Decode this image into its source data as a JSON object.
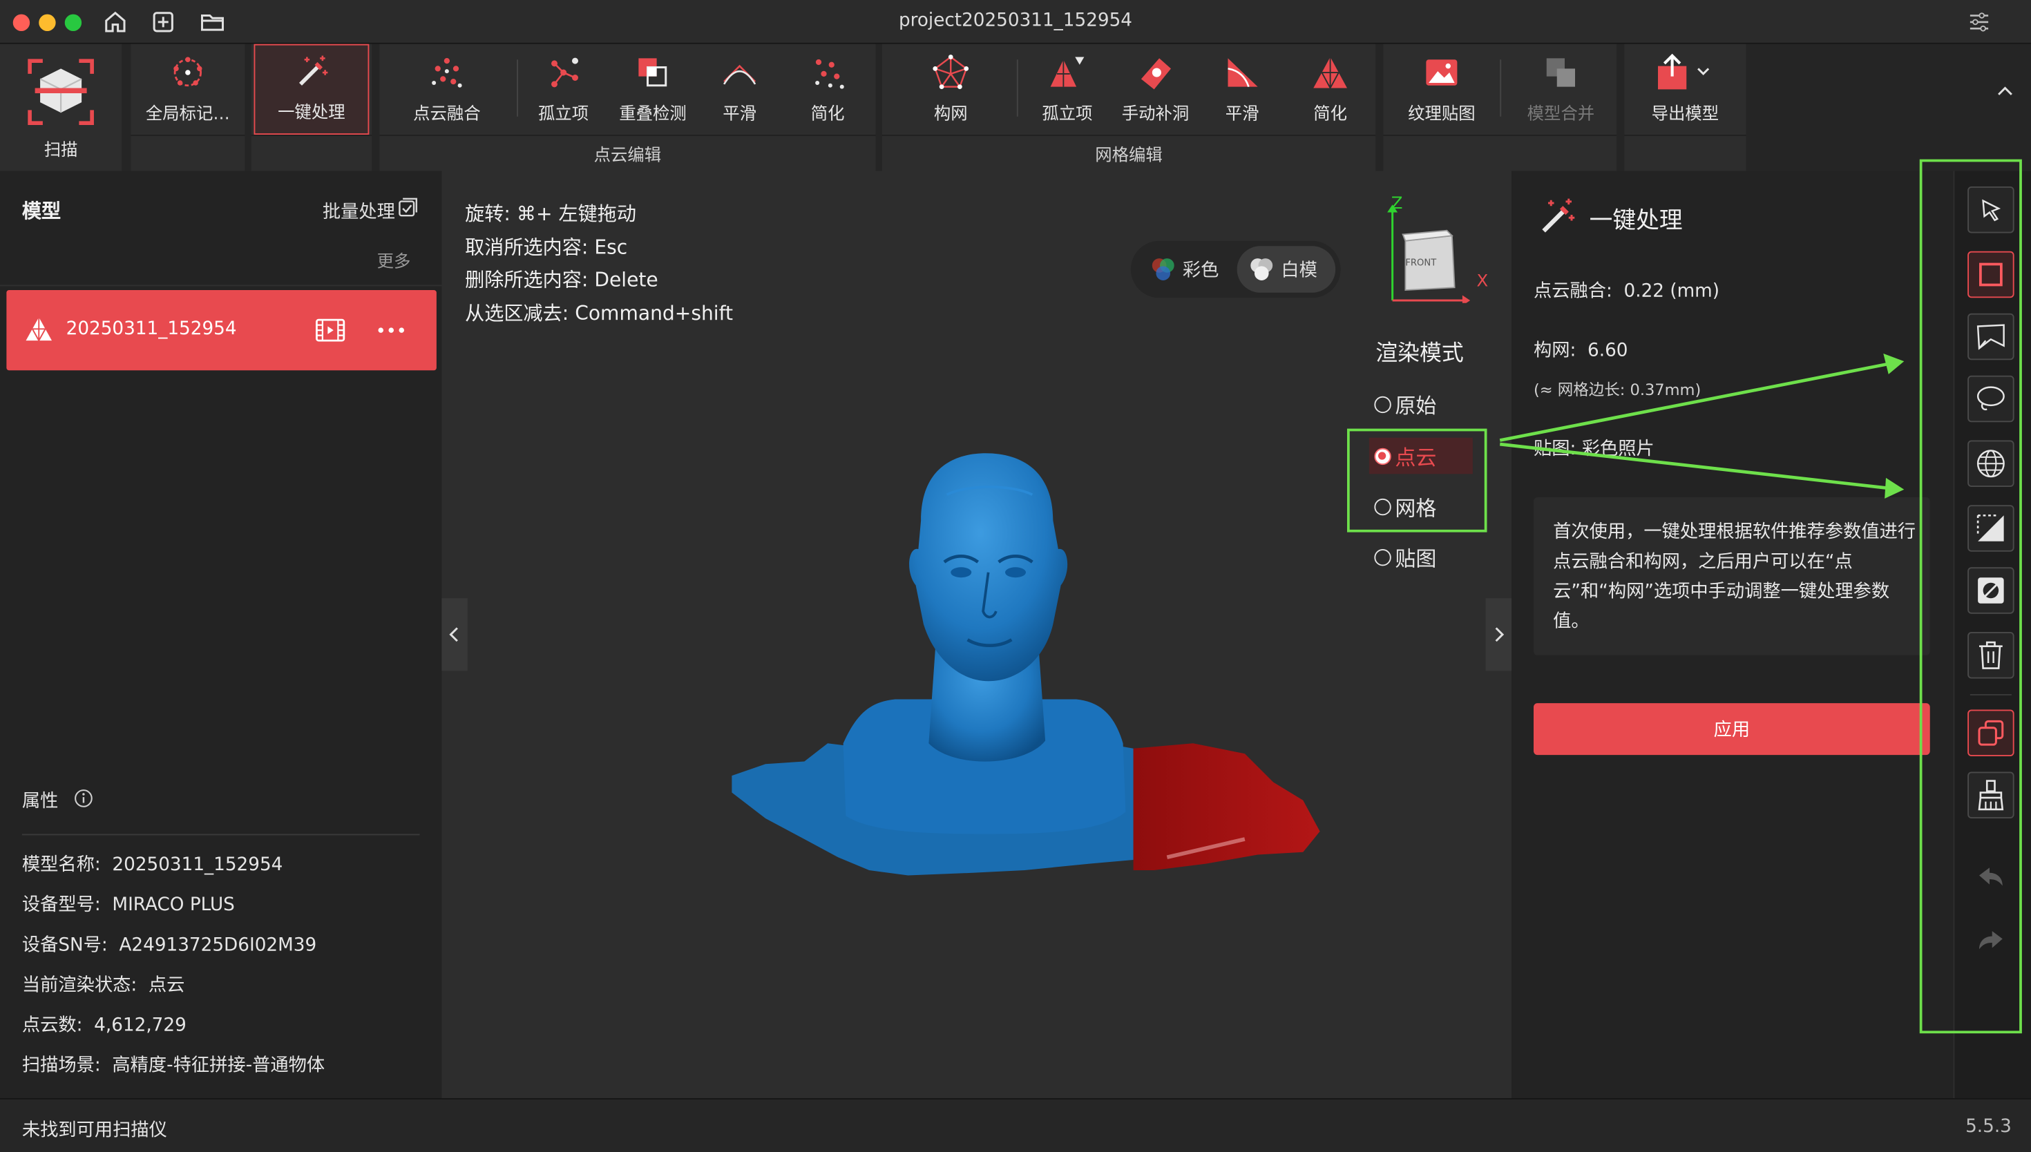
{
  "window": {
    "title": "project20250311_152954"
  },
  "toolbar": {
    "scan": "扫描",
    "global_marker": "全局标记…",
    "one_click": "一键处理",
    "pointcloud_group": {
      "label": "点云编辑",
      "fusion": "点云融合",
      "isolated": "孤立项",
      "overlap": "重叠检测",
      "smooth": "平滑",
      "simplify": "简化"
    },
    "mesh_group": {
      "label": "网格编辑",
      "mesh": "构网",
      "isolated": "孤立项",
      "fill_holes": "手动补洞",
      "smooth": "平滑",
      "simplify": "简化"
    },
    "texture": "纹理贴图",
    "merge": "模型合并",
    "export": "导出模型"
  },
  "left_panel": {
    "title": "模型",
    "batch": "批量处理",
    "more": "更多",
    "model_name": "20250311_152954",
    "props_title": "属性",
    "props": [
      {
        "label": "模型名称:",
        "value": "20250311_152954"
      },
      {
        "label": "设备型号:",
        "value": "MIRACO PLUS"
      },
      {
        "label": "设备SN号:",
        "value": "A24913725D6I02M39"
      },
      {
        "label": "当前渲染状态:",
        "value": "点云"
      },
      {
        "label": "点云数:",
        "value": "4,612,729"
      },
      {
        "label": "扫描场景:",
        "value": "高精度-特征拼接-普通物体"
      }
    ]
  },
  "viewport": {
    "hints": [
      {
        "label": "旋转:",
        "value": "⌘+ 左键拖动"
      },
      {
        "label": "取消所选内容:",
        "value": "Esc"
      },
      {
        "label": "删除所选内容:",
        "value": "Delete"
      },
      {
        "label": "从选区减去:",
        "value": "Command+shift"
      }
    ],
    "color_mode": {
      "color": "彩色",
      "white": "白模",
      "selected": "白模"
    },
    "axis": {
      "z": "Z",
      "x": "X",
      "cube_label": "FRONT"
    },
    "render_mode": {
      "title": "渲染模式",
      "options": [
        "原始",
        "点云",
        "网格",
        "贴图"
      ],
      "selected": "点云"
    }
  },
  "right_panel": {
    "title": "一键处理",
    "fusion": {
      "label": "点云融合:",
      "value": "0.22 (mm)"
    },
    "mesh": {
      "label": "构网:",
      "value": "6.60"
    },
    "mesh_edge": "(≈ 网格边长: 0.37mm)",
    "texture": {
      "label": "贴图:",
      "value": "彩色照片"
    },
    "info": "首次使用，一键处理根据软件推荐参数值进行点云融合和构网，之后用户可以在“点云”和“构网”选项中手动调整一键处理参数值。",
    "apply": "应用"
  },
  "status": {
    "left": "未找到可用扫描仪",
    "version": "5.5.3"
  },
  "colors": {
    "accent": "#e84a4f",
    "annotation": "#6ee04b",
    "model_blue": "#1f78c0",
    "model_red": "#9e1111"
  }
}
